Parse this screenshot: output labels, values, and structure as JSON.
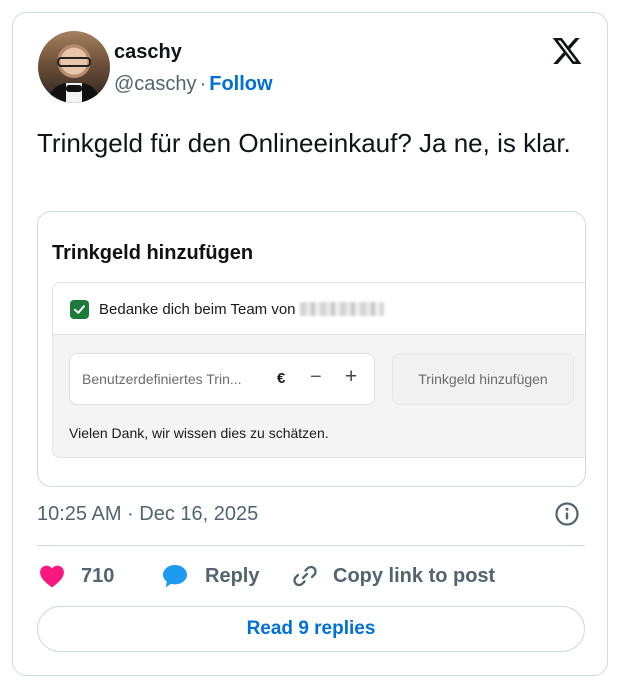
{
  "author": {
    "name": "caschy",
    "handle": "@caschy",
    "separator": "·",
    "follow_label": "Follow"
  },
  "tweet": {
    "text": "Trinkgeld für den Onlineeinkauf? Ja ne, is klar.",
    "timestamp": "10:25 AM · Dec 16, 2025"
  },
  "embedded_screenshot": {
    "title": "Trinkgeld hinzufügen",
    "checkbox_label": "Bedanke dich beim Team von",
    "checkbox_checked": true,
    "input_placeholder": "Benutzerdefiniertes Trin...",
    "currency_symbol": "€",
    "minus_symbol": "−",
    "plus_symbol": "+",
    "add_button_label": "Trinkgeld hinzufügen",
    "thanks_text": "Vielen Dank, wir wissen dies zu schätzen.",
    "checkbox_color": "#1c7a3a"
  },
  "actions": {
    "like_count": "710",
    "reply_label": "Reply",
    "copy_link_label": "Copy link to post",
    "like_color": "#f91880",
    "reply_color": "#1d9bf0"
  },
  "read_replies_label": "Read 9 replies",
  "icons": {
    "platform": "x-logo-icon",
    "info": "info-icon",
    "like": "heart-icon",
    "reply": "speech-bubble-icon",
    "copy": "link-icon"
  },
  "colors": {
    "link_blue": "#006fd6",
    "secondary_text": "#536471",
    "border": "#cfd9de"
  }
}
